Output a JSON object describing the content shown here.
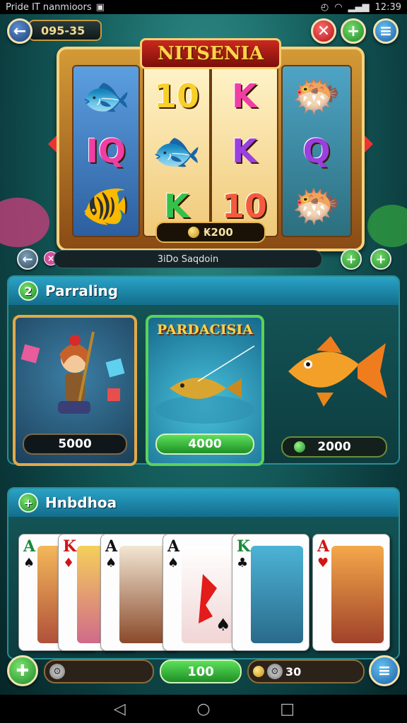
{
  "status_bar": {
    "left_text": "Pride IT nanmioors",
    "time": "12:39"
  },
  "top_bar": {
    "coin_value": "095-35"
  },
  "slot": {
    "title": "NITSENIA",
    "reels": [
      [
        "fish",
        "IQ",
        "fish"
      ],
      [
        "10",
        "fish",
        "K"
      ],
      [
        "K",
        "K",
        "10"
      ],
      [
        "fish",
        "Q",
        "fish"
      ]
    ],
    "win_amount": "₭200",
    "info_bar": "3iDo Saqdoin"
  },
  "panel1": {
    "badge": "2",
    "title": "Parraling",
    "tiles": [
      {
        "title": "",
        "value": "5000"
      },
      {
        "title": "PARDACISIA",
        "value": "4000"
      },
      {
        "title": "",
        "value": "2000"
      }
    ]
  },
  "panel2": {
    "badge": "+",
    "title": "Hnbdhoa",
    "cards": [
      {
        "rank": "A",
        "suit": "♠"
      },
      {
        "rank": "K",
        "suit": "♦"
      },
      {
        "rank": "A",
        "suit": "♠"
      },
      {
        "rank": "A",
        "suit": "♠"
      },
      {
        "rank": "K",
        "suit": "♣"
      },
      {
        "rank": "A",
        "suit": "♥"
      }
    ]
  },
  "bottom_bar": {
    "center_value": "100",
    "right_value": "30"
  },
  "colors": {
    "accent_green": "#2a9a35",
    "accent_blue": "#1b5fa4",
    "gold": "#f4cf6d"
  },
  "icons": [
    "back-arrow-icon",
    "close-icon",
    "plus-icon",
    "menu-icon",
    "coin-icon",
    "settings-icon",
    "nav-back-icon",
    "nav-home-icon",
    "nav-recents-icon"
  ]
}
